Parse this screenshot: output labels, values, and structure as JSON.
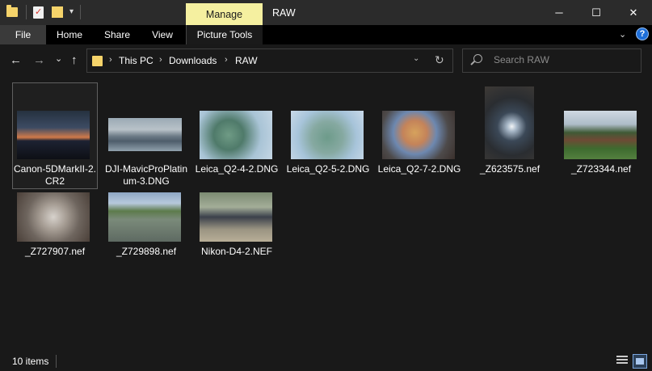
{
  "titlebar": {
    "manage_label": "Manage",
    "window_title": "RAW",
    "minimize_glyph": "─",
    "maximize_glyph": "☐",
    "close_glyph": "✕"
  },
  "ribbon": {
    "tabs": [
      {
        "label": "File"
      },
      {
        "label": "Home"
      },
      {
        "label": "Share"
      },
      {
        "label": "View"
      },
      {
        "label": "Picture Tools"
      }
    ],
    "expand_glyph": "⌄",
    "help_glyph": "?"
  },
  "nav": {
    "back_glyph": "←",
    "forward_glyph": "→",
    "recent_glyph": "⌄",
    "up_glyph": "↑",
    "breadcrumb": [
      "This PC",
      "Downloads",
      "RAW"
    ],
    "crumb_separator": "›",
    "refresh_glyph": "↻",
    "dropdown_glyph": "⌄"
  },
  "search": {
    "placeholder": "Search RAW",
    "value": ""
  },
  "files": [
    {
      "name": "Canon-5DMarkII-2.CR2",
      "selected": true
    },
    {
      "name": "DJI-MavicProPlatinum-3.DNG"
    },
    {
      "name": "Leica_Q2-4-2.DNG"
    },
    {
      "name": "Leica_Q2-5-2.DNG"
    },
    {
      "name": "Leica_Q2-7-2.DNG"
    },
    {
      "name": "_Z623575.nef"
    },
    {
      "name": "_Z723344.nef"
    },
    {
      "name": "_Z727907.nef"
    },
    {
      "name": "_Z729898.nef"
    },
    {
      "name": "Nikon-D4-2.NEF"
    }
  ],
  "status": {
    "item_count": "10 items"
  },
  "colors": {
    "manage_tab": "#f5f0a0",
    "folder": "#f5d36a",
    "help": "#1e6fd9"
  }
}
